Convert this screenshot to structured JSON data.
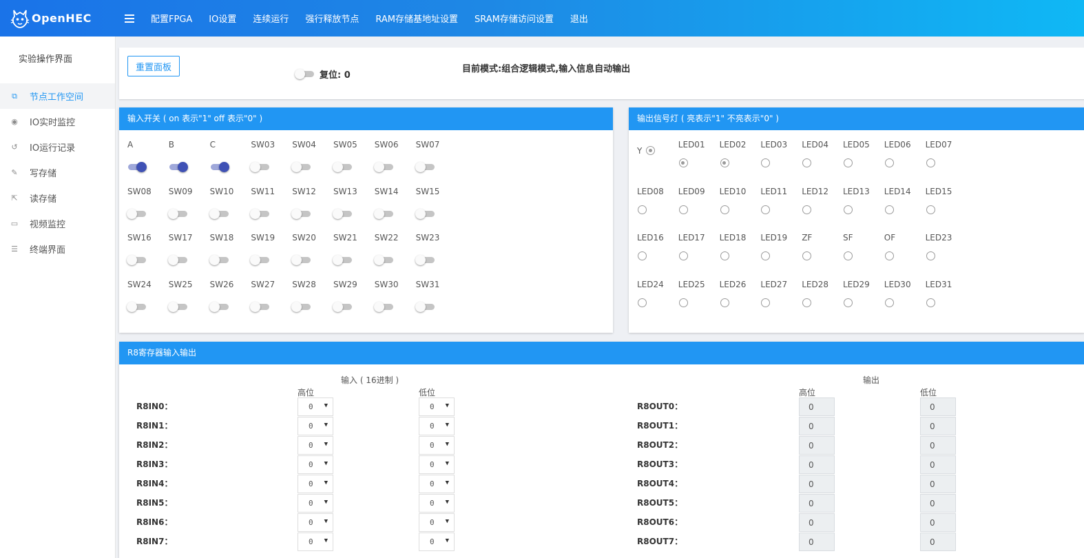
{
  "header": {
    "logo_text": "OpenHEC",
    "nav": [
      "配置FPGA",
      "IO设置",
      "连续运行",
      "强行释放节点",
      "RAM存储基地址设置",
      "SRAM存储访问设置",
      "退出"
    ]
  },
  "sidebar": {
    "title": "实验操作界面",
    "items": [
      {
        "label": "节点工作空间",
        "icon": "copy-icon",
        "active": true
      },
      {
        "label": "IO实时监控",
        "icon": "eye-icon",
        "active": false
      },
      {
        "label": "IO运行记录",
        "icon": "history-icon",
        "active": false
      },
      {
        "label": "写存储",
        "icon": "pencil-icon",
        "active": false
      },
      {
        "label": "读存储",
        "icon": "export-icon",
        "active": false
      },
      {
        "label": "视频监控",
        "icon": "video-icon",
        "active": false
      },
      {
        "label": "终端界面",
        "icon": "list-icon",
        "active": false
      }
    ]
  },
  "controls": {
    "reset_panel_label": "重置面板",
    "reset_label": "复位: 0",
    "reset_on": false,
    "mode_text": "目前模式:组合逻辑模式,输入信息自动输出"
  },
  "switches": {
    "title": "输入开关 ( on 表示\"1\" off 表示\"0\" )",
    "labels": [
      "A",
      "B",
      "C",
      "SW03",
      "SW04",
      "SW05",
      "SW06",
      "SW07",
      "SW08",
      "SW09",
      "SW10",
      "SW11",
      "SW12",
      "SW13",
      "SW14",
      "SW15",
      "SW16",
      "SW17",
      "SW18",
      "SW19",
      "SW20",
      "SW21",
      "SW22",
      "SW23",
      "SW24",
      "SW25",
      "SW26",
      "SW27",
      "SW28",
      "SW29",
      "SW30",
      "SW31"
    ],
    "states": [
      true,
      true,
      true,
      false,
      false,
      false,
      false,
      false,
      false,
      false,
      false,
      false,
      false,
      false,
      false,
      false,
      false,
      false,
      false,
      false,
      false,
      false,
      false,
      false,
      false,
      false,
      false,
      false,
      false,
      false,
      false,
      false
    ]
  },
  "leds": {
    "title": "输出信号灯 ( 亮表示\"1\" 不亮表示\"0\" )",
    "y_label": "Y",
    "y_on": true,
    "labels": [
      "LED01",
      "LED02",
      "LED03",
      "LED04",
      "LED05",
      "LED06",
      "LED07",
      "LED08",
      "LED09",
      "LED10",
      "LED11",
      "LED12",
      "LED13",
      "LED14",
      "LED15",
      "LED16",
      "LED17",
      "LED18",
      "LED19",
      "ZF",
      "SF",
      "OF",
      "LED23",
      "LED24",
      "LED25",
      "LED26",
      "LED27",
      "LED28",
      "LED29",
      "LED30",
      "LED31"
    ],
    "states": [
      true,
      true,
      false,
      false,
      false,
      false,
      false,
      false,
      false,
      false,
      false,
      false,
      false,
      false,
      false,
      false,
      false,
      false,
      false,
      false,
      false,
      false,
      false,
      false,
      false,
      false,
      false,
      false,
      false,
      false,
      false
    ]
  },
  "register": {
    "title": "R8寄存器输入输出",
    "input_header": "输入 ( 16进制 )",
    "output_header": "输出",
    "high_label": "高位",
    "low_label": "低位",
    "input_labels": [
      "R8IN0：",
      "R8IN1：",
      "R8IN2：",
      "R8IN3：",
      "R8IN4：",
      "R8IN5：",
      "R8IN6：",
      "R8IN7："
    ],
    "output_labels": [
      "R8OUT0：",
      "R8OUT1：",
      "R8OUT2：",
      "R8OUT3：",
      "R8OUT4：",
      "R8OUT5：",
      "R8OUT6：",
      "R8OUT7："
    ],
    "input_high": [
      "0",
      "0",
      "0",
      "0",
      "0",
      "0",
      "0",
      "0"
    ],
    "input_low": [
      "0",
      "0",
      "0",
      "0",
      "0",
      "0",
      "0",
      "0"
    ],
    "output_high": [
      "0",
      "0",
      "0",
      "0",
      "0",
      "0",
      "0",
      "0"
    ],
    "output_low": [
      "0",
      "0",
      "0",
      "0",
      "0",
      "0",
      "0",
      "0"
    ]
  }
}
